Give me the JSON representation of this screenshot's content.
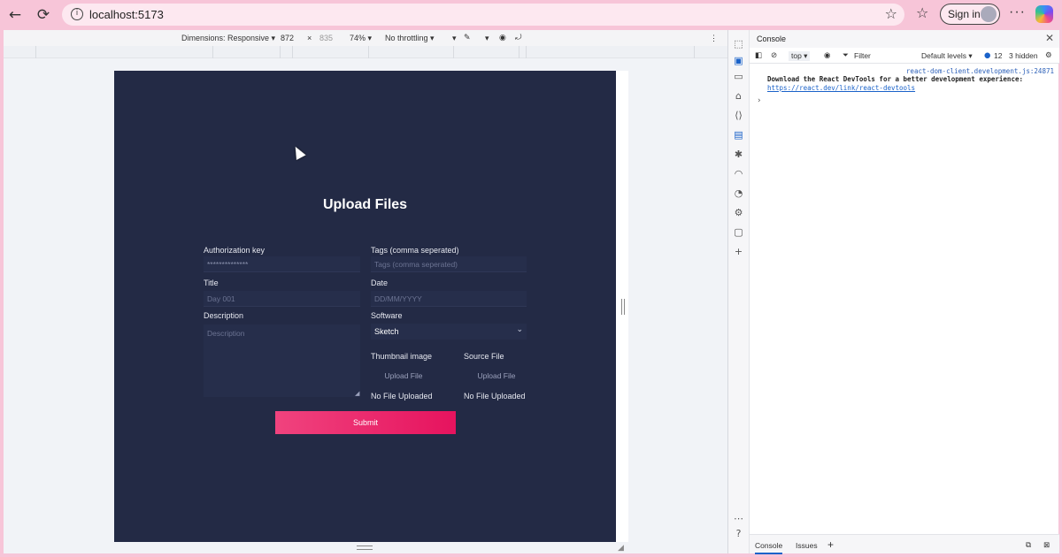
{
  "browser": {
    "url": "localhost:5173",
    "signin_label": "Sign in",
    "back_icon": "←",
    "reload_icon": "⟳",
    "info_icon": "i",
    "star_icon": "☆",
    "favorites_icon": "☆",
    "more_icon": "···"
  },
  "device_toolbar": {
    "dimensions_label": "Dimensions: Responsive ▾",
    "width": "872",
    "times": "×",
    "height": "835",
    "zoom": "74% ▾",
    "throttling": "No throttling ▾",
    "rotate": "▾",
    "more": "⋮"
  },
  "app": {
    "title": "Upload Files",
    "auth_label": "Authorization key",
    "auth_value": "**************",
    "tags_label": "Tags (comma seperated)",
    "tags_placeholder": "Tags (comma seperated)",
    "title_label": "Title",
    "title_placeholder": "Day 001",
    "date_label": "Date",
    "date_placeholder": "DD/MM/YYYY",
    "description_label": "Description",
    "description_placeholder": "Description",
    "software_label": "Software",
    "software_value": "Sketch",
    "thumbnail_label": "Thumbnail image",
    "source_label": "Source File",
    "upload_label": "Upload File",
    "upload_label_2": "Upload File",
    "no_file_thumb": "No File Uploaded",
    "no_file_source": "No File Uploaded",
    "submit_label": "Submit"
  },
  "devtools": {
    "panel_title": "Console",
    "close_icon": "✕",
    "context": "top ▾",
    "filter": "Filter",
    "levels": "Default levels ▾",
    "count": "12",
    "hidden": "3 hidden",
    "source_link": "react-dom-client.development.js:24871",
    "message": "Download the React DevTools for a better development experience:",
    "message_link": "https://react.dev/link/react-devtools",
    "prompt": "›",
    "drawer_console": "Console",
    "drawer_issues": "Issues",
    "drawer_add": "+"
  }
}
